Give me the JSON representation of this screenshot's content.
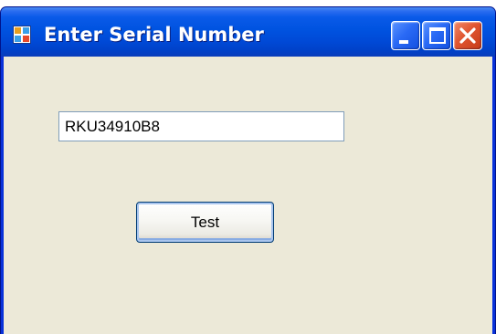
{
  "window": {
    "title": "Enter Serial Number"
  },
  "titlebar_buttons": {
    "minimize_icon": "minimize-icon",
    "maximize_icon": "maximize-icon",
    "close_icon": "close-icon"
  },
  "form": {
    "serial_input_value": "RKU34910B8",
    "test_button_label": "Test"
  },
  "colors": {
    "titlebar": "#0053e0",
    "client_background": "#ece9d8",
    "close_button": "#e05530"
  }
}
